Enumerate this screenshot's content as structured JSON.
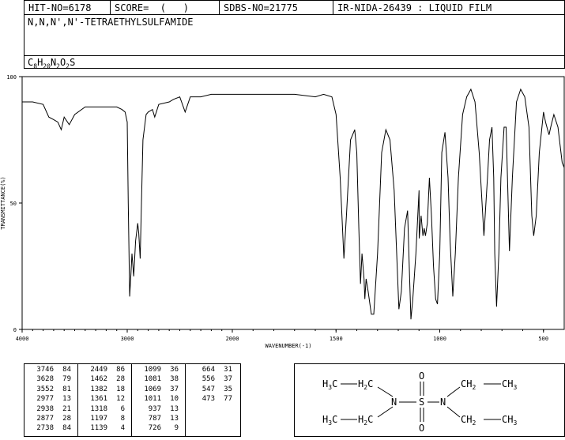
{
  "header": {
    "hit_no": "HIT-NO=6178",
    "score": "SCORE=  (   )",
    "sdbs_no": "SDBS-NO=21775",
    "ir_info": "IR-NIDA-26439 : LIQUID FILM",
    "compound_name": "N,N,N',N'-TETRAETHYLSULFAMIDE",
    "formula": "C8H20N2O2S"
  },
  "chart_data": {
    "type": "line",
    "title": "",
    "xlabel": "WAVENUMBER(-1)",
    "ylabel": "TRANSMITTANCE(%)",
    "xlim": [
      4000,
      400
    ],
    "ylim": [
      0,
      100
    ],
    "x_ticks": [
      4000,
      3000,
      2000,
      1500,
      1000,
      500
    ],
    "y_ticks": [
      0,
      50,
      100
    ],
    "grid": false,
    "x": [
      4000,
      3900,
      3800,
      3746,
      3700,
      3660,
      3628,
      3600,
      3552,
      3500,
      3400,
      3300,
      3200,
      3100,
      3050,
      3020,
      3000,
      2990,
      2977,
      2965,
      2955,
      2938,
      2920,
      2900,
      2890,
      2877,
      2865,
      2850,
      2820,
      2800,
      2760,
      2738,
      2700,
      2600,
      2560,
      2500,
      2449,
      2400,
      2300,
      2200,
      2100,
      2000,
      1900,
      1800,
      1700,
      1600,
      1560,
      1520,
      1500,
      1480,
      1462,
      1450,
      1430,
      1410,
      1400,
      1390,
      1382,
      1375,
      1365,
      1361,
      1355,
      1345,
      1330,
      1318,
      1300,
      1280,
      1260,
      1240,
      1220,
      1197,
      1185,
      1170,
      1155,
      1145,
      1139,
      1130,
      1115,
      1100,
      1099,
      1090,
      1081,
      1075,
      1069,
      1060,
      1050,
      1040,
      1030,
      1020,
      1011,
      1000,
      990,
      975,
      960,
      950,
      937,
      925,
      910,
      890,
      870,
      850,
      830,
      810,
      787,
      770,
      760,
      748,
      740,
      735,
      726,
      715,
      705,
      690,
      680,
      664,
      650,
      630,
      610,
      590,
      570,
      556,
      547,
      535,
      520,
      500,
      490,
      480,
      473,
      465,
      450,
      430,
      410,
      400
    ],
    "y": [
      90,
      90,
      89,
      84,
      83,
      82,
      79,
      84,
      81,
      85,
      88,
      88,
      88,
      88,
      87,
      86,
      82,
      50,
      13,
      22,
      30,
      21,
      35,
      42,
      38,
      28,
      50,
      75,
      85,
      86,
      87,
      84,
      89,
      90,
      91,
      92,
      86,
      92,
      92,
      93,
      93,
      93,
      93,
      93,
      93,
      92,
      93,
      92,
      85,
      60,
      28,
      45,
      75,
      79,
      70,
      40,
      18,
      30,
      20,
      12,
      20,
      15,
      6,
      6,
      30,
      70,
      79,
      75,
      55,
      8,
      15,
      40,
      47,
      20,
      4,
      12,
      30,
      55,
      36,
      45,
      37,
      40,
      37,
      42,
      60,
      45,
      25,
      12,
      10,
      30,
      70,
      78,
      60,
      35,
      13,
      30,
      60,
      85,
      92,
      95,
      90,
      70,
      37,
      60,
      75,
      80,
      60,
      30,
      9,
      30,
      60,
      80,
      80,
      31,
      60,
      90,
      95,
      92,
      80,
      45,
      37,
      45,
      70,
      86,
      82,
      79,
      77,
      80,
      85,
      80,
      66,
      64
    ]
  },
  "peak_table": [
    [
      "3746",
      "84",
      "2449",
      "86",
      "1099",
      "36",
      "664",
      "31"
    ],
    [
      "3628",
      "79",
      "1462",
      "28",
      "1081",
      "38",
      "556",
      "37"
    ],
    [
      "3552",
      "81",
      "1382",
      "18",
      "1069",
      "37",
      "547",
      "35"
    ],
    [
      "2977",
      "13",
      "1361",
      "12",
      "1011",
      "10",
      "473",
      "77"
    ],
    [
      "2938",
      "21",
      "1318",
      "6",
      "937",
      "13",
      "",
      ""
    ],
    [
      "2877",
      "28",
      "1197",
      "8",
      "787",
      "13",
      "",
      ""
    ],
    [
      "2738",
      "84",
      "1139",
      "4",
      "726",
      "9",
      "",
      ""
    ]
  ],
  "structure": {
    "sulfur": "S",
    "oxygen_top": "O",
    "oxygen_bottom": "O",
    "nitrogen_left": "N",
    "nitrogen_right": "N"
  }
}
